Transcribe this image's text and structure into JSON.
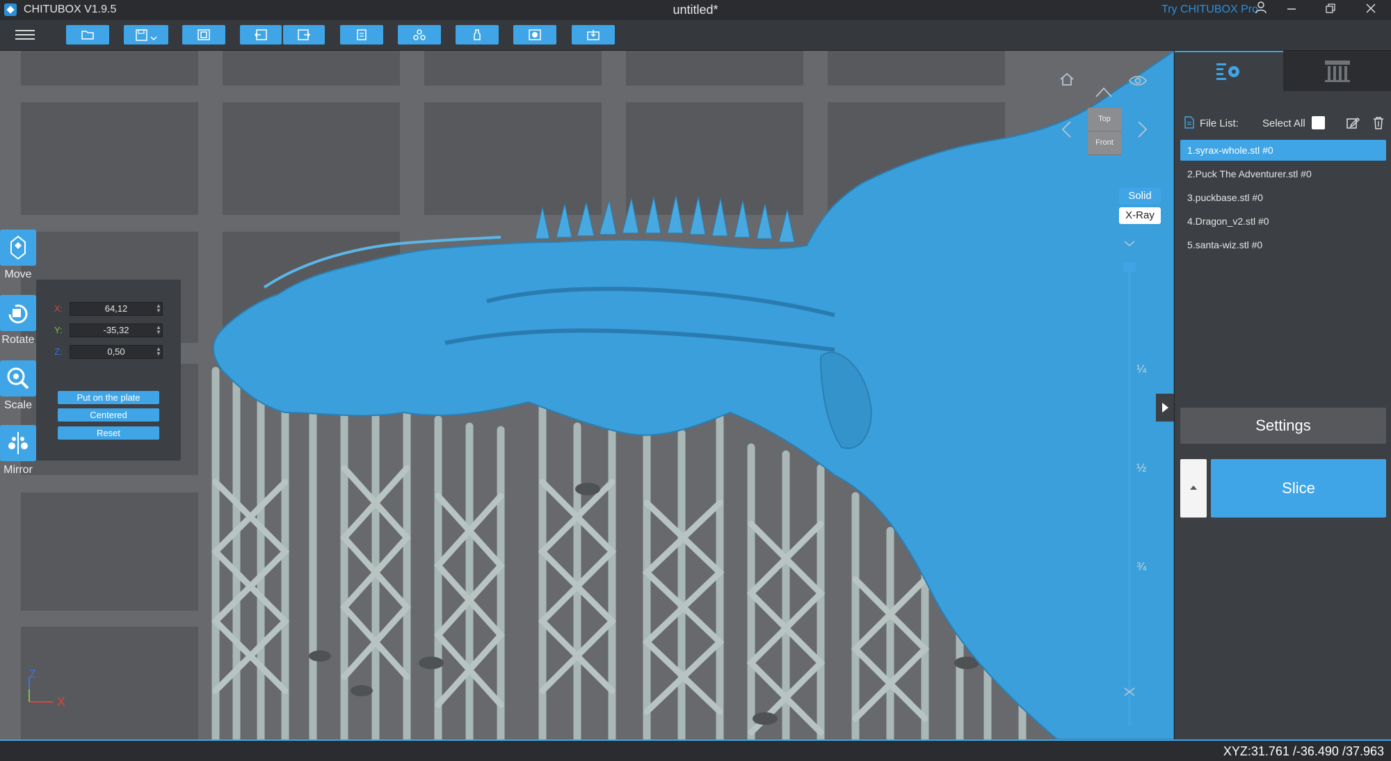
{
  "titlebar": {
    "app_name": "CHITUBOX V1.9.5",
    "doc_title": "untitled*",
    "try_pro": "Try CHITUBOX Pro",
    "buttons": [
      "user-icon",
      "minimize-icon",
      "restore-icon",
      "close-icon"
    ]
  },
  "toolbar": {
    "buttons": [
      "open-file-icon",
      "save-icon",
      "auto-arrange-icon",
      "undo-icon",
      "redo-icon",
      "duplicate-icon",
      "hollow-icon",
      "support-icon",
      "drain-icon",
      "plate-icon"
    ]
  },
  "tools": {
    "move": "Move",
    "rotate": "Rotate",
    "scale": "Scale",
    "mirror": "Mirror"
  },
  "move_panel": {
    "x_label": "X:",
    "y_label": "Y:",
    "z_label": "Z:",
    "x_value": "64,12",
    "y_value": "-35,32",
    "z_value": "0,50",
    "put_on_plate": "Put on the plate",
    "centered": "Centered",
    "reset": "Reset"
  },
  "viewcube": {
    "top": "Top",
    "front": "Front"
  },
  "render_mode": {
    "solid": "Solid",
    "xray": "X-Ray"
  },
  "layer_slider": {
    "quarter": "¼",
    "half": "½",
    "three_quarter": "¾"
  },
  "axis_indicator": {
    "z": "Z",
    "x": "X"
  },
  "right_panel": {
    "file_list_label": "File List:",
    "select_all": "Select All",
    "files": [
      "1.syrax-whole.stl #0",
      "2.Puck The Adventurer.stl #0",
      "3.puckbase.stl #0",
      "4.Dragon_v2.stl #0",
      "5.santa-wiz.stl #0"
    ],
    "settings": "Settings",
    "slice": "Slice"
  },
  "statusbar": {
    "xyz": "XYZ:31.761 /-36.490 /37.963"
  },
  "colors": {
    "accent": "#3fa5e6",
    "model": "#3a9fda",
    "support": "#a9b8b6",
    "viewport": "#67696c"
  }
}
